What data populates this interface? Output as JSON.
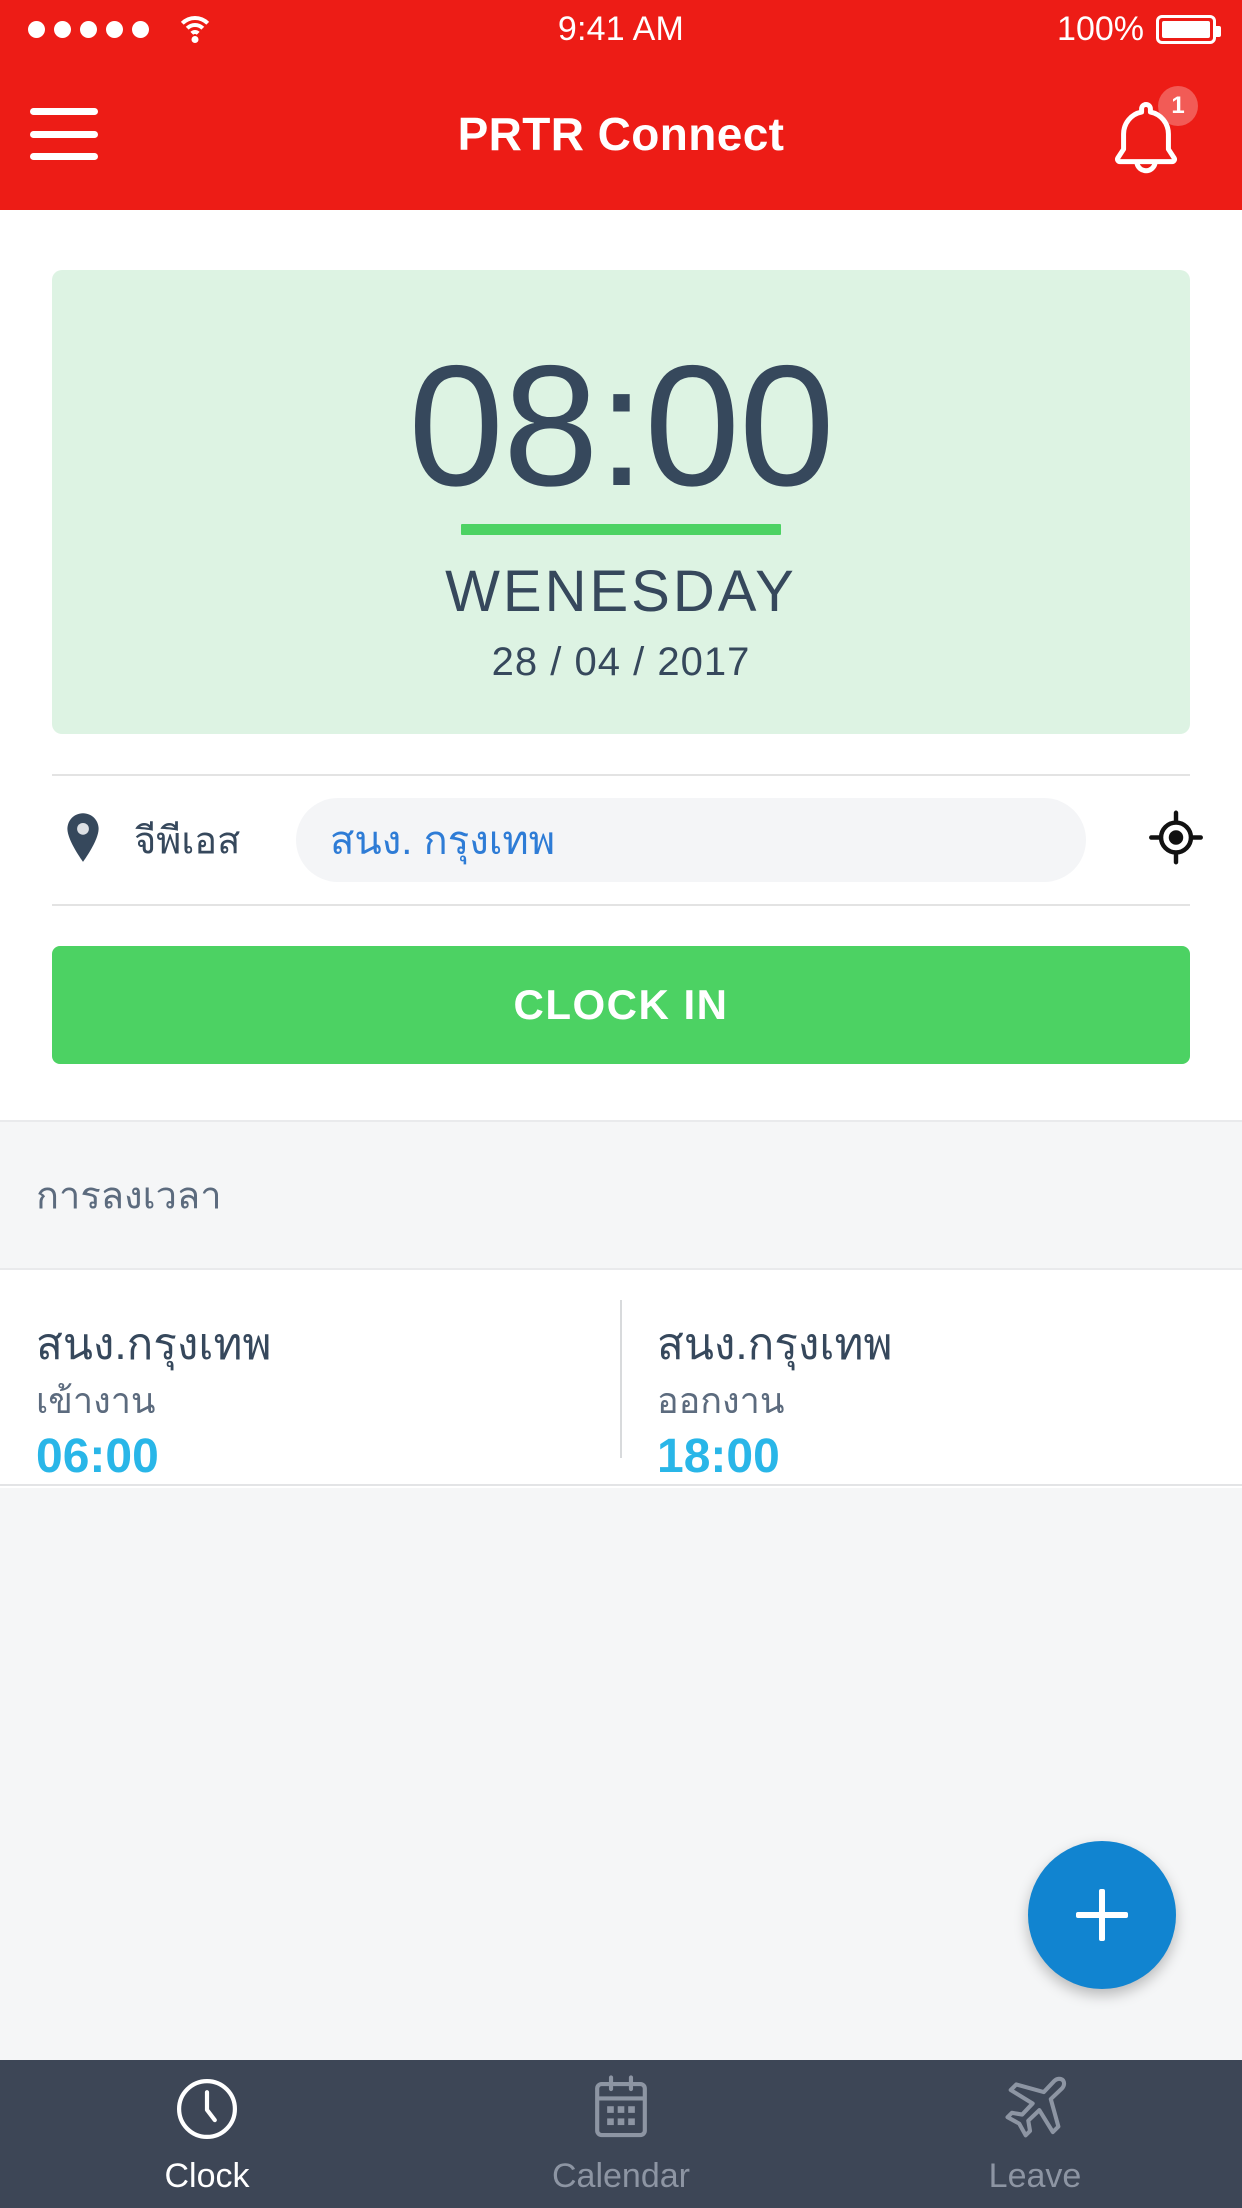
{
  "status_bar": {
    "time": "9:41 AM",
    "battery_percent": "100%",
    "signal_icon": "signal-dots-icon",
    "wifi_icon": "wifi-icon",
    "battery_icon": "battery-full-icon"
  },
  "app_bar": {
    "title": "PRTR Connect",
    "menu_icon": "hamburger-menu-icon",
    "notification_icon": "bell-icon",
    "notification_count": "1",
    "background_color": "#ED1C16"
  },
  "clock_card": {
    "time": "08:00",
    "day": "WENESDAY",
    "date": "28 / 04 / 2017",
    "background_color": "#DDF3E3",
    "accent_color": "#4CD263",
    "text_color": "#36485C"
  },
  "gps": {
    "pin_icon": "map-pin-icon",
    "label": "จีพีเอส",
    "value": "สนง. กรุงเทพ",
    "value_color": "#2E7CD6",
    "locate_icon": "crosshair-locate-icon"
  },
  "primary_action": {
    "label": "CLOCK IN",
    "color": "#4CD263"
  },
  "log_section": {
    "header": "การลงเวลา",
    "entries": [
      {
        "site": "สนง.กรุงเทพ",
        "type": "เข้างาน",
        "time": "06:00"
      },
      {
        "site": "สนง.กรุงเทพ",
        "type": "ออกงาน",
        "time": "18:00"
      }
    ],
    "time_color": "#29B6E8"
  },
  "fab": {
    "icon": "plus-icon",
    "color": "#1184D0"
  },
  "bottom_nav": {
    "background_color": "#3D4656",
    "items": [
      {
        "label": "Clock",
        "icon": "clock-icon",
        "active": true
      },
      {
        "label": "Calendar",
        "icon": "calendar-icon",
        "active": false
      },
      {
        "label": "Leave",
        "icon": "airplane-icon",
        "active": false
      }
    ]
  }
}
